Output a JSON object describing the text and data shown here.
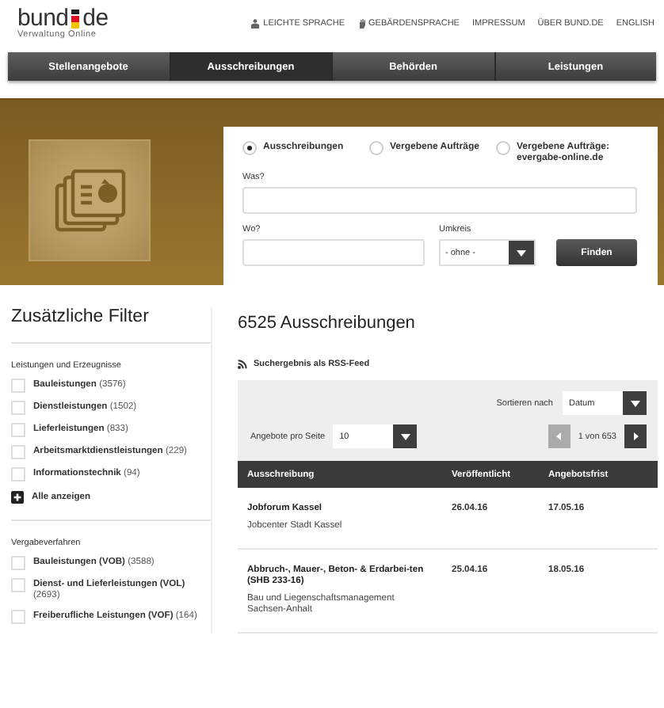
{
  "header": {
    "logo": {
      "brand_left": "bund",
      "brand_right": "de",
      "tagline": "Verwaltung Online"
    },
    "links": [
      {
        "label": "LEICHTE SPRACHE",
        "kind": "reader"
      },
      {
        "label": "GEBÄRDENSPRACHE",
        "kind": "sign"
      },
      {
        "label": "IMPRESSUM",
        "kind": "plain"
      },
      {
        "label": "ÜBER BUND.DE",
        "kind": "plain"
      },
      {
        "label": "ENGLISH",
        "kind": "plain"
      }
    ]
  },
  "nav": [
    {
      "label": "Stellenangebote",
      "selected": false
    },
    {
      "label": "Ausschreibungen",
      "selected": true
    },
    {
      "label": "Behörden",
      "selected": false
    },
    {
      "label": "Leistungen",
      "selected": false
    }
  ],
  "search": {
    "options": [
      {
        "label": "Ausschreibungen",
        "selected": true
      },
      {
        "label": "Vergebene Aufträge",
        "selected": false
      },
      {
        "label": "Vergebene Aufträge: evergabe-online.de",
        "selected": false
      }
    ],
    "what_label": "Was?",
    "where_label": "Wo?",
    "radius_label": "Umkreis",
    "radius_value": "- ohne -",
    "submit": "Finden"
  },
  "sidebar": {
    "title": "Zusätzliche Filter",
    "groups": [
      {
        "title": "Leistungen und Erzeugnisse",
        "items": [
          {
            "label": "Bauleistungen",
            "count": "(3576)",
            "checked": false
          },
          {
            "label": "Dienstleistungen",
            "count": "(1502)",
            "checked": false
          },
          {
            "label": "Lieferleistungen",
            "count": "(833)",
            "checked": false
          },
          {
            "label": "Arbeitsmarktdienstleistungen",
            "count": "(229)",
            "checked": false
          },
          {
            "label": "Informationstechnik",
            "count": "(94)",
            "checked": false
          }
        ],
        "show_all": "Alle anzeigen"
      },
      {
        "title": "Vergabeverfahren",
        "items": [
          {
            "label": "Bauleistungen (VOB)",
            "count": "(3588)",
            "checked": false
          },
          {
            "label": "Dienst- und Lieferleistungen (VOL)",
            "count": "(2693)",
            "checked": false
          },
          {
            "label": "Freiberufliche Leistungen (VOF)",
            "count": "(164)",
            "checked": false
          }
        ]
      }
    ]
  },
  "results": {
    "title": "6525 Ausschreibungen",
    "rss": "Suchergebnis als RSS-Feed",
    "sort_label": "Sortieren nach",
    "sort_value": "Datum",
    "per_page_label": "Angebote pro Seite",
    "per_page_value": "10",
    "pager": "1 von 653",
    "prev_disabled": true,
    "next_disabled": false,
    "columns": [
      "Ausschreibung",
      "Veröffentlicht",
      "Angebotsfrist"
    ],
    "rows": [
      {
        "title": "Jobforum Kassel",
        "agency": "Jobcenter Stadt Kassel",
        "published": "26.04.16",
        "deadline": "17.05.16"
      },
      {
        "title": "Abbruch-, Mauer-, Beton- & Erdarbei-ten (SHB 233-16)",
        "agency": "Bau und Liegenschaftsmanagement Sachsen-Anhalt",
        "published": "25.04.16",
        "deadline": "18.05.16"
      }
    ]
  }
}
